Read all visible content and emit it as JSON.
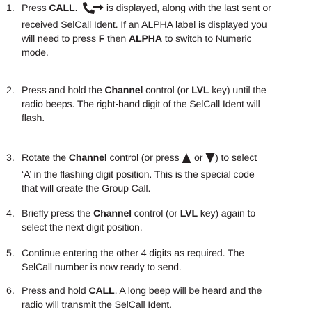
{
  "steps": [
    {
      "num": "1.",
      "lines": [
        [
          {
            "t": "Press "
          },
          {
            "t": "CALL",
            "b": true
          },
          {
            "t": ". "
          },
          {
            "icon": "call-handset-arrow-icon"
          },
          {
            "t": " is displayed, along with the last sent or"
          }
        ],
        [
          {
            "t": "received SelCall Ident. If an ALPHA label is displayed you"
          }
        ],
        [
          {
            "t": "will need to press "
          },
          {
            "t": "F",
            "b": true
          },
          {
            "t": " then "
          },
          {
            "t": "ALPHA",
            "b": true
          },
          {
            "t": " to switch to Numeric"
          }
        ],
        [
          {
            "t": "mode."
          }
        ]
      ]
    },
    {
      "num": "2.",
      "lines": [
        [
          {
            "t": "Press and hold the "
          },
          {
            "t": "Channel",
            "b": true
          },
          {
            "t": " control (or "
          },
          {
            "t": "LVL",
            "b": true
          },
          {
            "t": "  key) until the"
          }
        ],
        [
          {
            "t": "radio beeps. The right-hand digit of the SelCall Ident will"
          }
        ],
        [
          {
            "t": "flash."
          }
        ]
      ]
    },
    {
      "num": "3.",
      "lines": [
        [
          {
            "t": "Rotate the "
          },
          {
            "t": "Channel",
            "b": true
          },
          {
            "t": " control (or press "
          },
          {
            "icon": "up-triangle-icon"
          },
          {
            "t": " or "
          },
          {
            "icon": "down-triangle-icon"
          },
          {
            "t": ") to select"
          }
        ],
        [
          {
            "t": "‘A’ in the flashing digit position. This is the special code"
          }
        ],
        [
          {
            "t": "that will create the Group Call."
          }
        ]
      ]
    },
    {
      "num": "4.",
      "lines": [
        [
          {
            "t": "Briefly press the "
          },
          {
            "t": "Channel",
            "b": true
          },
          {
            "t": " control (or  "
          },
          {
            "t": "LVL",
            "b": true
          },
          {
            "t": " key) again to"
          }
        ],
        [
          {
            "t": "select the next digit position."
          }
        ]
      ]
    },
    {
      "num": "5.",
      "lines": [
        [
          {
            "t": "Continue entering the other 4 digits as required. The"
          }
        ],
        [
          {
            "t": "SelCall number is now ready to send."
          }
        ]
      ]
    },
    {
      "num": "6.",
      "lines": [
        [
          {
            "t": "Press and hold "
          },
          {
            "t": "CALL",
            "b": true
          },
          {
            "t": ". A long beep will be heard and the"
          }
        ],
        [
          {
            "t": "radio will transmit the SelCall Ident."
          }
        ]
      ]
    }
  ]
}
